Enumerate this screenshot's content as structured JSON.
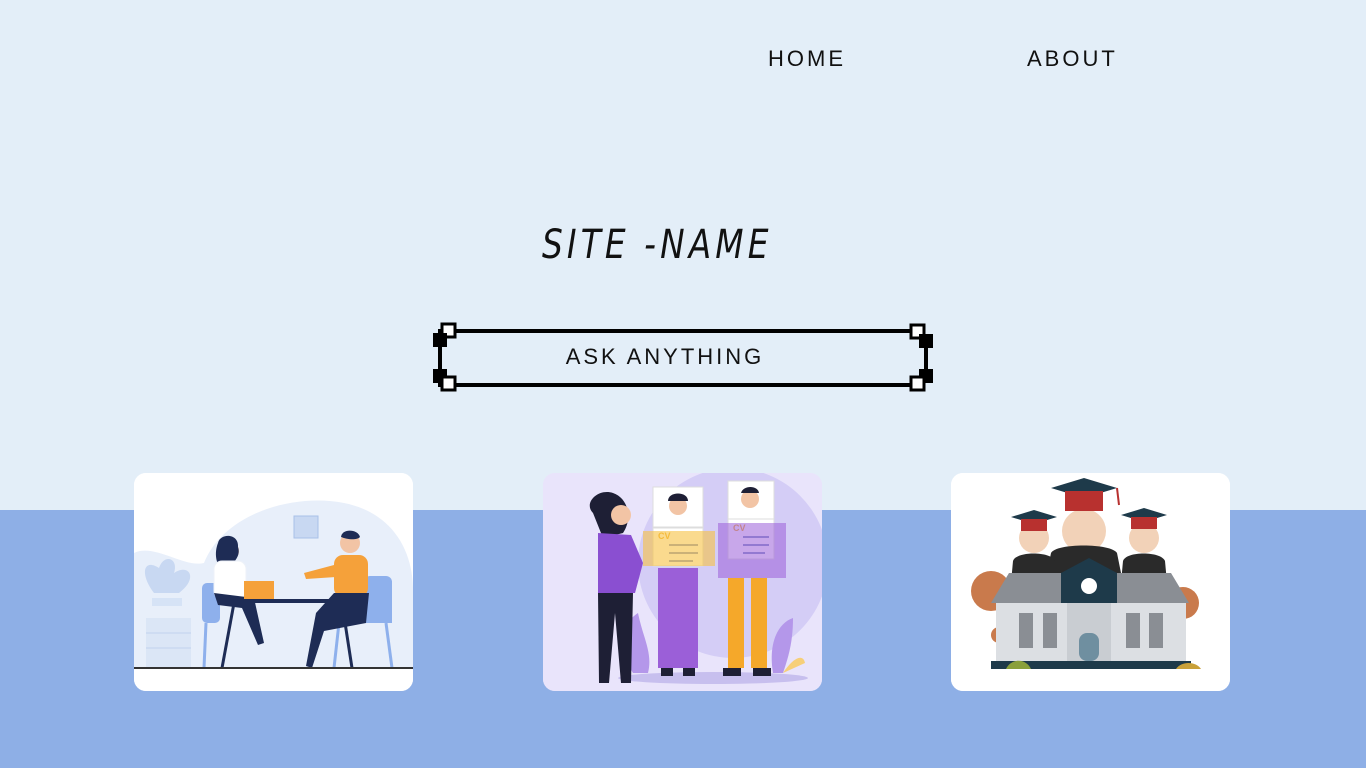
{
  "nav": {
    "home_label": "HOME",
    "about_label": "ABOUT"
  },
  "hero": {
    "site_name": "SITE -NAME",
    "ask_label": "ASK ANYTHING"
  },
  "colors": {
    "page_bg": "#e3eef8",
    "band_bg": "#8eafe6",
    "accent": "#111111"
  },
  "cards": [
    {
      "illustration": "meeting-illustration"
    },
    {
      "illustration": "cv-illustration"
    },
    {
      "illustration": "graduation-illustration"
    }
  ]
}
